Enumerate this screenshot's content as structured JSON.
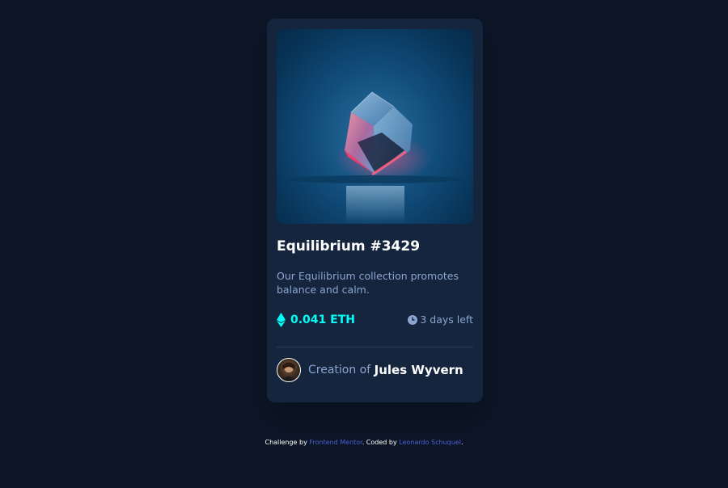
{
  "card": {
    "image_alt": "Equilibrium",
    "title": "Equilibrium #3429",
    "description": "Our Equilibrium collection promotes balance and calm.",
    "price": "0.041 ETH",
    "time_left": "3 days left",
    "creation_label": "Creation of ",
    "creator_name": "Jules Wyvern",
    "icons": {
      "price": "ethereum-icon",
      "time": "clock-icon"
    }
  },
  "attribution": {
    "challenge_prefix": "Challenge by ",
    "challenge_link": "Frontend Mentor",
    "coded_prefix": ". Coded by ",
    "coded_link": "Leonardo Schuquel",
    "suffix": "."
  },
  "colors": {
    "page_background": "#0d1627",
    "card_background": "#15253e",
    "accent_cyan": "#00fff7",
    "soft_blue": "#8ba6cf",
    "link_blue": "#4d5fd6",
    "white": "#ffffff"
  }
}
